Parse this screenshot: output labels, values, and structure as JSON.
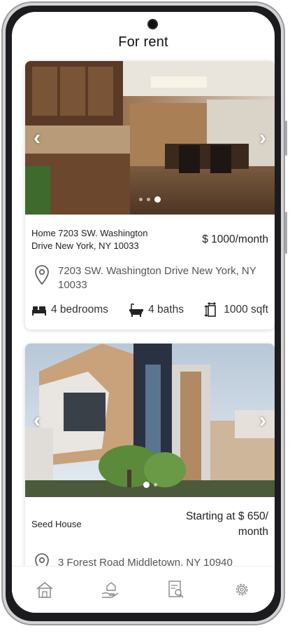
{
  "header": {
    "title": "For rent"
  },
  "listings": [
    {
      "name": "Home 7203 SW. Washington Drive New York, NY 10033",
      "price": "$ 1000/month",
      "address": "7203 SW. Washington Drive New York, NY 10033",
      "bedrooms": "4 bedrooms",
      "baths": "4 baths",
      "area": "1000 sqft",
      "carousel": {
        "slide": 3,
        "slides": 3
      }
    },
    {
      "name": "Seed House",
      "price": "Starting at $ 650/ month",
      "address": "3 Forest Road Middletown, NY 10940",
      "carousel": {
        "slide": 1,
        "slides": 2
      }
    }
  ],
  "nav": {
    "items": [
      {
        "icon": "home-icon"
      },
      {
        "icon": "hand-house-icon"
      },
      {
        "icon": "document-search-icon"
      },
      {
        "icon": "gear-icon"
      }
    ]
  },
  "colors": {
    "card_shadow": "#cccccc",
    "icon": "#555555",
    "nav_icon": "#888888"
  }
}
